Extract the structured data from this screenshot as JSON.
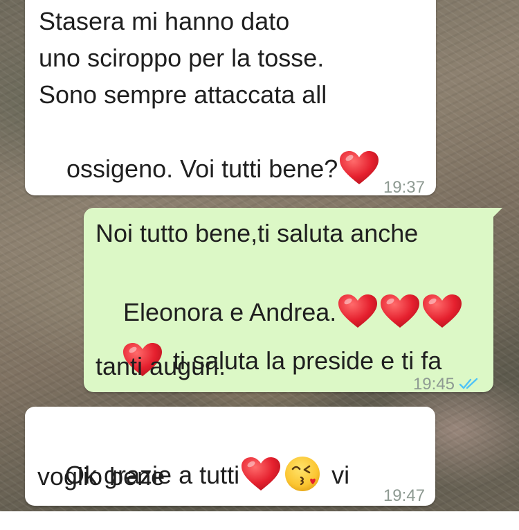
{
  "chat": {
    "messages": [
      {
        "direction": "incoming",
        "lines": [
          "Stasera mi hanno dato",
          "uno sciroppo per la tosse.",
          "Sono sempre attaccata all",
          "ossigeno. Voi tutti bene?"
        ],
        "time": "19:37"
      },
      {
        "direction": "outgoing",
        "line1": "Noi tutto bene,ti saluta anche",
        "line2": "Eleonora e Andrea.",
        "line3": "ti saluta la preside e ti fa",
        "line4": "tanti auguri.",
        "time": "19:45",
        "status": "read"
      },
      {
        "direction": "incoming",
        "line1a": "Ok grazie a tutti",
        "line1b": "vi",
        "line2": "voglio bene",
        "time": "19:47"
      }
    ]
  },
  "icons": {
    "heart": "red-heart-emoji",
    "kiss": "face-blowing-a-kiss-emoji",
    "ticks": "double-check-icon"
  },
  "colors": {
    "incoming_bubble": "#ffffff",
    "outgoing_bubble": "#dcf8c6",
    "heart": "#e5202e",
    "read_ticks": "#4fc3f7",
    "timestamp": "#8e9a92"
  }
}
